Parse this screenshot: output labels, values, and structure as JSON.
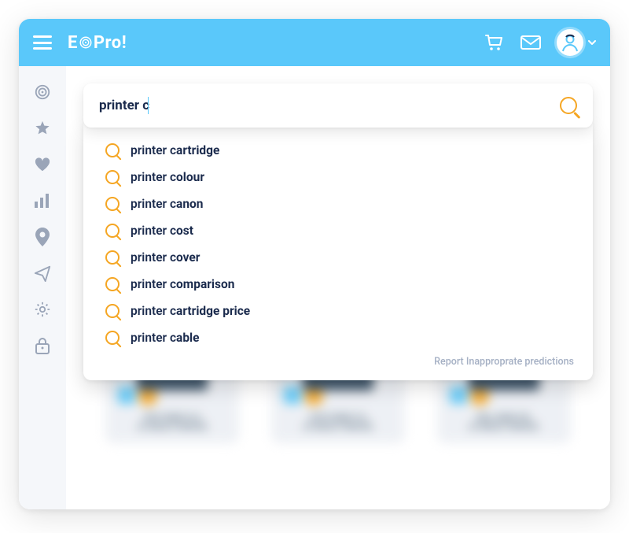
{
  "brand": {
    "text_1": "E",
    "text_2": "Pro!"
  },
  "header": {
    "cart_icon": "cart-icon",
    "mail_icon": "mail-icon",
    "avatar_icon": "avatar-icon"
  },
  "sidebar": {
    "items": [
      {
        "name": "target-icon"
      },
      {
        "name": "star-icon"
      },
      {
        "name": "heart-icon"
      },
      {
        "name": "bars-icon"
      },
      {
        "name": "pin-icon"
      },
      {
        "name": "send-icon"
      },
      {
        "name": "gear-icon"
      },
      {
        "name": "lock-icon"
      }
    ]
  },
  "search": {
    "value": "printer c",
    "placeholder": "Search",
    "suggestions": [
      {
        "prefix": "printer c",
        "suffix": "artridge"
      },
      {
        "prefix": "printer c",
        "suffix": "olour"
      },
      {
        "prefix": "printer c",
        "suffix": "anon"
      },
      {
        "prefix": "printer c",
        "suffix": "ost"
      },
      {
        "prefix": "printer c",
        "suffix": "over"
      },
      {
        "prefix": "printer c",
        "suffix": "omparison"
      },
      {
        "prefix": "printer c",
        "suffix": "artridge price"
      },
      {
        "prefix": "printer c",
        "suffix": "able"
      }
    ],
    "report_label": "Report Inapproprate predictions"
  },
  "products": [
    {
      "name_line1": "EPST RIDM T4.0",
      "name_line2": "AF INKJET PRINTER"
    },
    {
      "name_line1": "EITST RIDM T10",
      "name_line2": "AF INKJET PRINTER"
    },
    {
      "name_line1": "BELL RIDM T50",
      "name_line2": "AF INKJET PRINTER"
    }
  ]
}
